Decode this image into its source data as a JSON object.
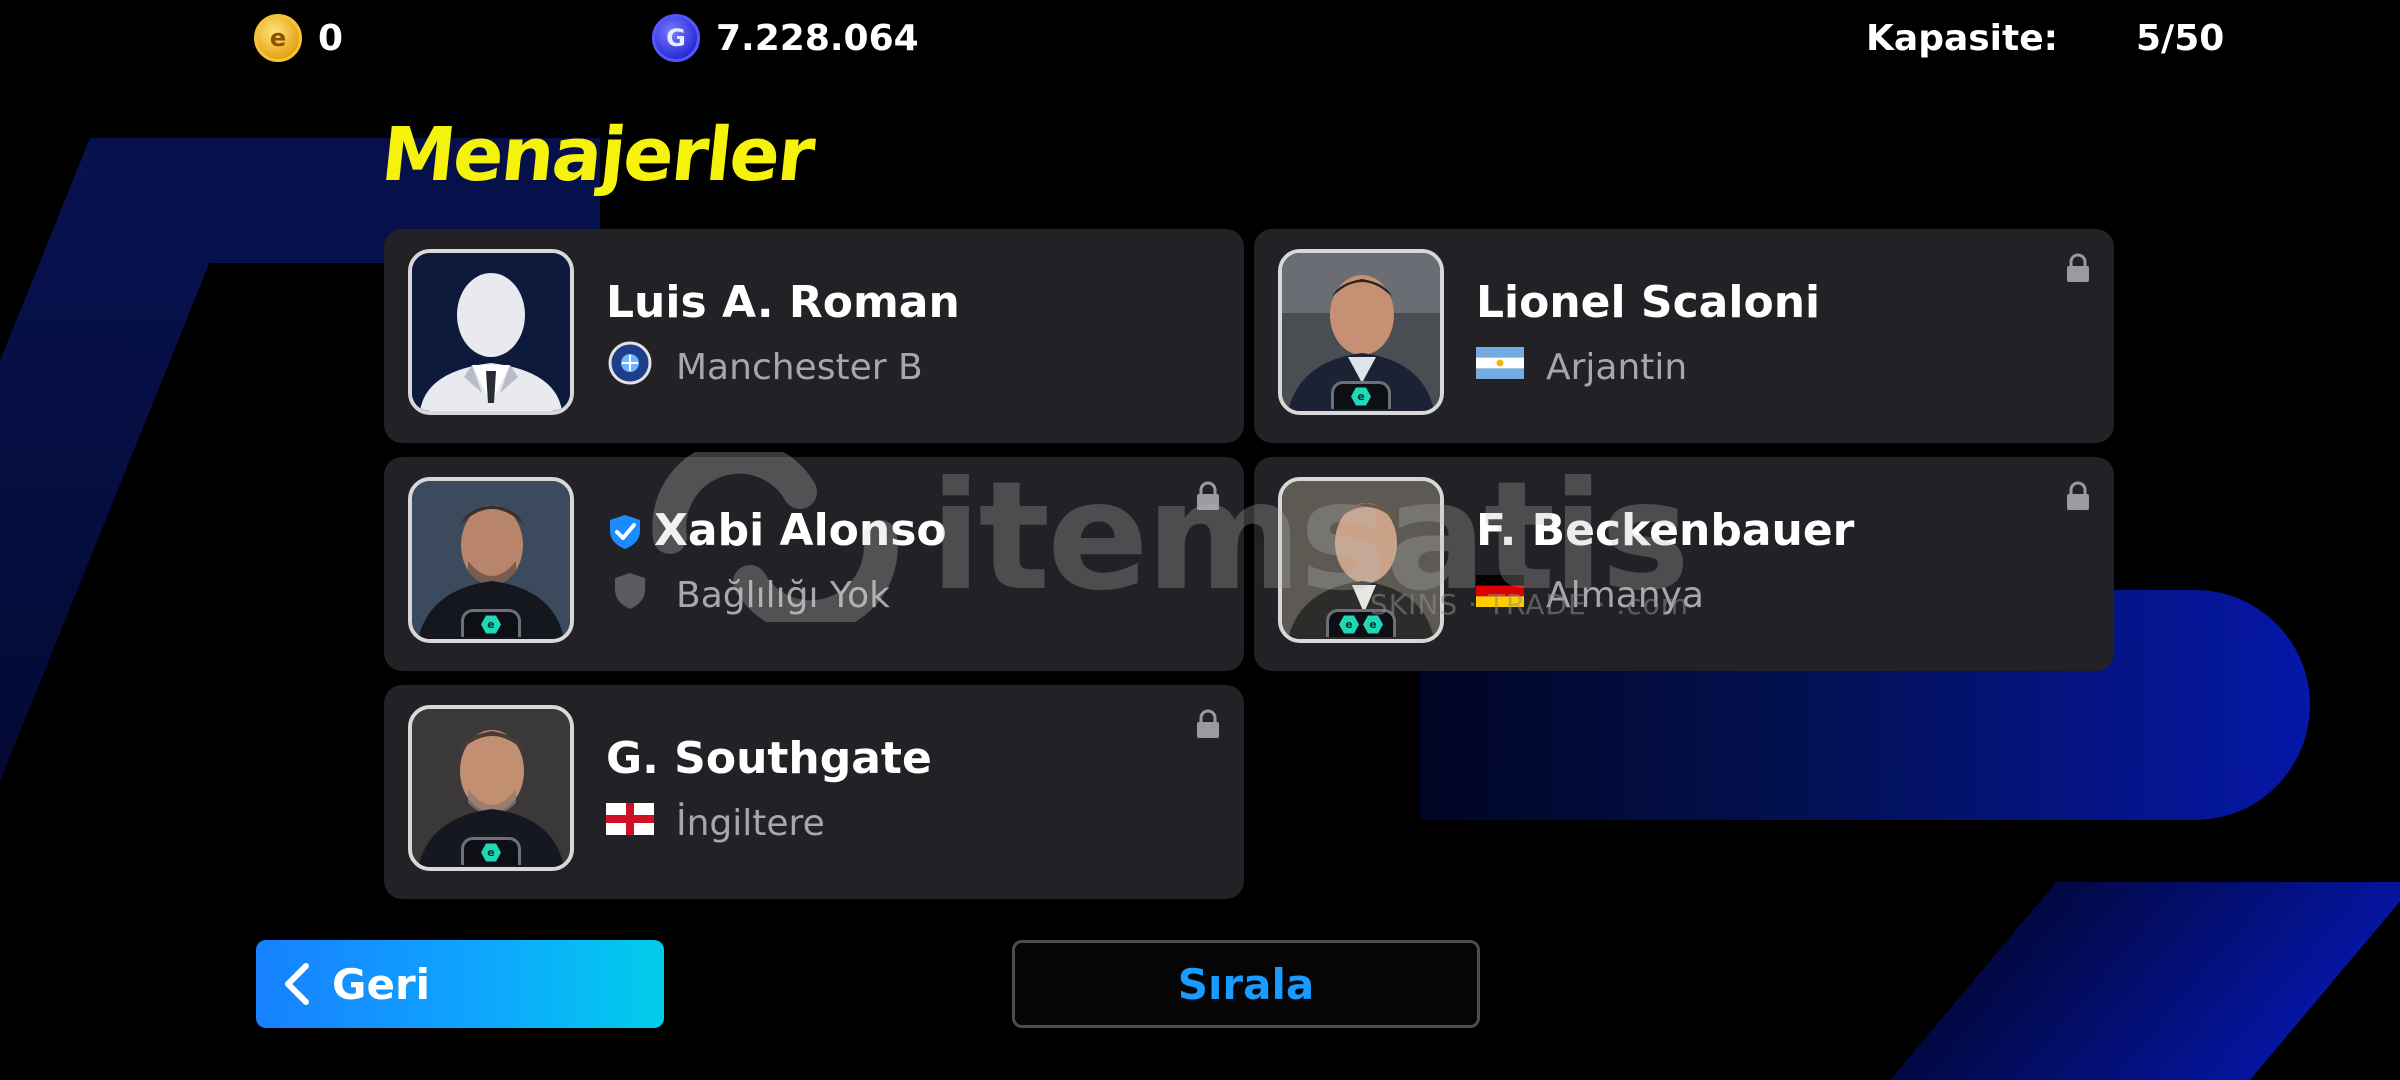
{
  "topbar": {
    "ecoin_symbol": "e",
    "ecoin_value": "0",
    "gp_symbol": "G",
    "gp_value": "7.228.064",
    "capacity_label": "Kapasite:",
    "capacity_value": "5/50"
  },
  "page": {
    "title": "Menajerler"
  },
  "managers": [
    {
      "name": "Luis A. Roman",
      "subtitle": "Manchester B",
      "sub_icon": "club-crest-icon",
      "locked": false,
      "verified": false,
      "badge_count": 0
    },
    {
      "name": "Lionel Scaloni",
      "subtitle": "Arjantin",
      "sub_icon": "argentina-flag-icon",
      "locked": true,
      "verified": false,
      "badge_count": 1
    },
    {
      "name": "Xabi Alonso",
      "subtitle": "Bağlılığı Yok",
      "sub_icon": "shield-icon",
      "locked": true,
      "verified": true,
      "badge_count": 1
    },
    {
      "name": "F. Beckenbauer",
      "subtitle": "Almanya",
      "sub_icon": "germany-flag-icon",
      "locked": true,
      "verified": false,
      "badge_count": 2
    },
    {
      "name": "G. Southgate",
      "subtitle": "İngiltere",
      "sub_icon": "england-flag-icon",
      "locked": true,
      "verified": false,
      "badge_count": 1
    }
  ],
  "badge_symbol": "e",
  "watermark": {
    "text": "itemsatis",
    "sub": "SKINS · TRADE · .com"
  },
  "buttons": {
    "back_label": "Geri",
    "sort_label": "Sırala"
  },
  "colors": {
    "title": "#f5f20c",
    "card_bg": "#222226",
    "accent_blue": "#1a9bff",
    "badge_green": "#1fd9b6"
  }
}
